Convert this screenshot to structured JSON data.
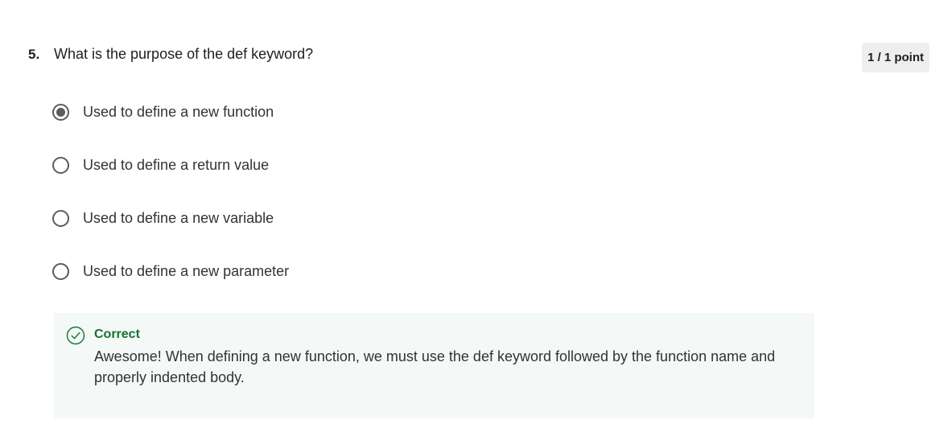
{
  "question": {
    "number": "5.",
    "text": "What is the purpose of the def keyword?",
    "points": "1 / 1 point"
  },
  "options": [
    {
      "label": "Used to define a new function",
      "selected": true
    },
    {
      "label": "Used to define a return value",
      "selected": false
    },
    {
      "label": "Used to define a new variable",
      "selected": false
    },
    {
      "label": "Used to define a new parameter",
      "selected": false
    }
  ],
  "feedback": {
    "status": "Correct",
    "icon": "check-circle-icon",
    "message": "Awesome! When defining a new function, we must use the def keyword followed by the function name and properly indented body."
  },
  "colors": {
    "correct": "#137333",
    "feedback_bg": "#f4f8f6",
    "radio": "#5b5b5b",
    "badge_bg": "#eeeeee"
  }
}
